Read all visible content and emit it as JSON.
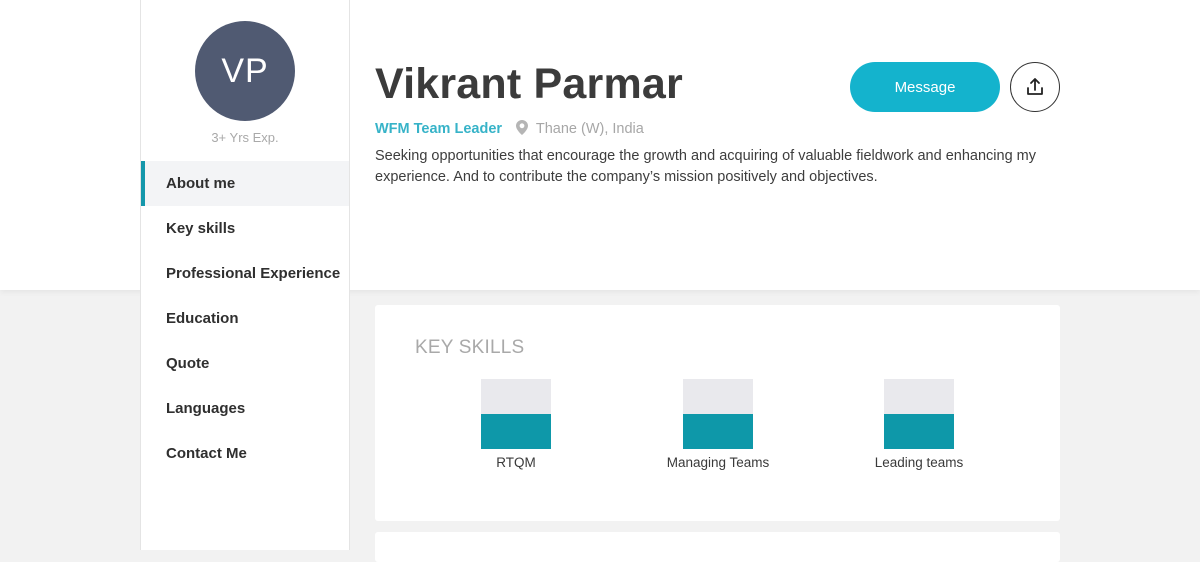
{
  "profile": {
    "initials": "VP",
    "experience": "3+ Yrs Exp.",
    "name": "Vikrant Parmar",
    "role": "WFM Team Leader",
    "location": "Thane (W), India",
    "summary": "Seeking opportunities that encourage the growth and acquiring of valuable fieldwork and enhancing my experience. And to contribute the company’s mission positively and objectives."
  },
  "actions": {
    "message_label": "Message",
    "share_icon": "share-upload-icon"
  },
  "nav": {
    "items": [
      {
        "label": "About me",
        "active": true
      },
      {
        "label": "Key skills",
        "active": false
      },
      {
        "label": "Professional Experience",
        "active": false
      },
      {
        "label": "Education",
        "active": false
      },
      {
        "label": "Quote",
        "active": false
      },
      {
        "label": "Languages",
        "active": false
      },
      {
        "label": "Contact Me",
        "active": false
      }
    ]
  },
  "key_skills": {
    "title": "KEY SKILLS",
    "skills": [
      {
        "name": "RTQM",
        "level": 0.5
      },
      {
        "name": "Managing Teams",
        "level": 0.5
      },
      {
        "name": "Leading teams",
        "level": 0.5
      }
    ]
  },
  "colors": {
    "accent": "#14b3cd",
    "avatar_bg": "#505a72",
    "skill_fill": "#0e98a9",
    "skill_track": "#e9e9ed",
    "role_text": "#37b3c8"
  }
}
